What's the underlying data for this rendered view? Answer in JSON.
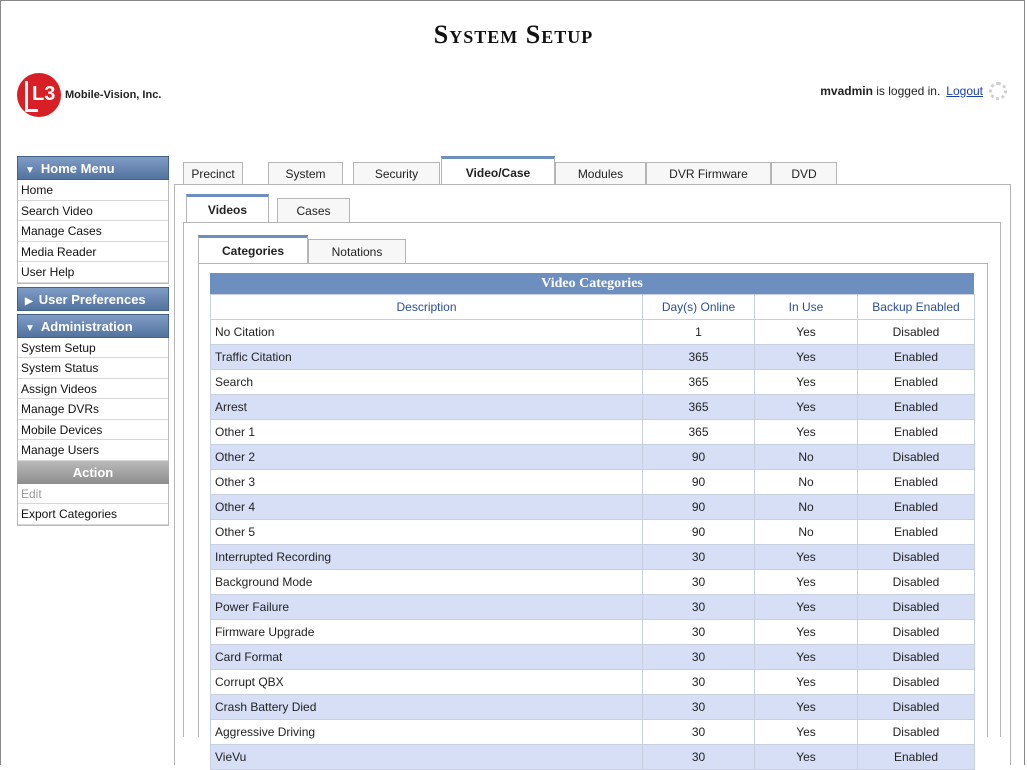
{
  "header": {
    "title": "System Setup",
    "logo_mark": "L3",
    "logo_text": "Mobile-Vision, Inc.",
    "user": "mvadmin",
    "logged_in_text": "is logged in.",
    "logout_label": "Logout"
  },
  "sidebar": {
    "home_menu": {
      "title": "Home Menu",
      "items": [
        "Home",
        "Search Video",
        "Manage Cases",
        "Media Reader",
        "User Help"
      ]
    },
    "user_prefs": {
      "title": "User Preferences"
    },
    "administration": {
      "title": "Administration",
      "items": [
        "System Setup",
        "System Status",
        "Assign Videos",
        "Manage DVRs",
        "Mobile Devices",
        "Manage Users"
      ]
    },
    "action": {
      "title": "Action",
      "items": [
        "Edit",
        "Export Categories"
      ]
    }
  },
  "tabs": [
    "Precinct",
    "System",
    "Security",
    "Video/Case",
    "Modules",
    "DVR Firmware",
    "DVD"
  ],
  "subtabs": [
    "Videos",
    "Cases"
  ],
  "subsubtabs": [
    "Categories",
    "Notations"
  ],
  "table": {
    "caption": "Video Categories",
    "columns": [
      "Description",
      "Day(s) Online",
      "In Use",
      "Backup Enabled"
    ],
    "rows": [
      [
        "No Citation",
        "1",
        "Yes",
        "Disabled"
      ],
      [
        "Traffic Citation",
        "365",
        "Yes",
        "Enabled"
      ],
      [
        "Search",
        "365",
        "Yes",
        "Enabled"
      ],
      [
        "Arrest",
        "365",
        "Yes",
        "Enabled"
      ],
      [
        "Other 1",
        "365",
        "Yes",
        "Enabled"
      ],
      [
        "Other 2",
        "90",
        "No",
        "Disabled"
      ],
      [
        "Other 3",
        "90",
        "No",
        "Enabled"
      ],
      [
        "Other 4",
        "90",
        "No",
        "Enabled"
      ],
      [
        "Other 5",
        "90",
        "No",
        "Enabled"
      ],
      [
        "Interrupted Recording",
        "30",
        "Yes",
        "Disabled"
      ],
      [
        "Background Mode",
        "30",
        "Yes",
        "Disabled"
      ],
      [
        "Power Failure",
        "30",
        "Yes",
        "Disabled"
      ],
      [
        "Firmware Upgrade",
        "30",
        "Yes",
        "Disabled"
      ],
      [
        "Card Format",
        "30",
        "Yes",
        "Disabled"
      ],
      [
        "Corrupt QBX",
        "30",
        "Yes",
        "Disabled"
      ],
      [
        "Crash Battery Died",
        "30",
        "Yes",
        "Disabled"
      ],
      [
        "Aggressive Driving",
        "30",
        "Yes",
        "Disabled"
      ],
      [
        "VieVu",
        "30",
        "Yes",
        "Enabled"
      ]
    ]
  }
}
